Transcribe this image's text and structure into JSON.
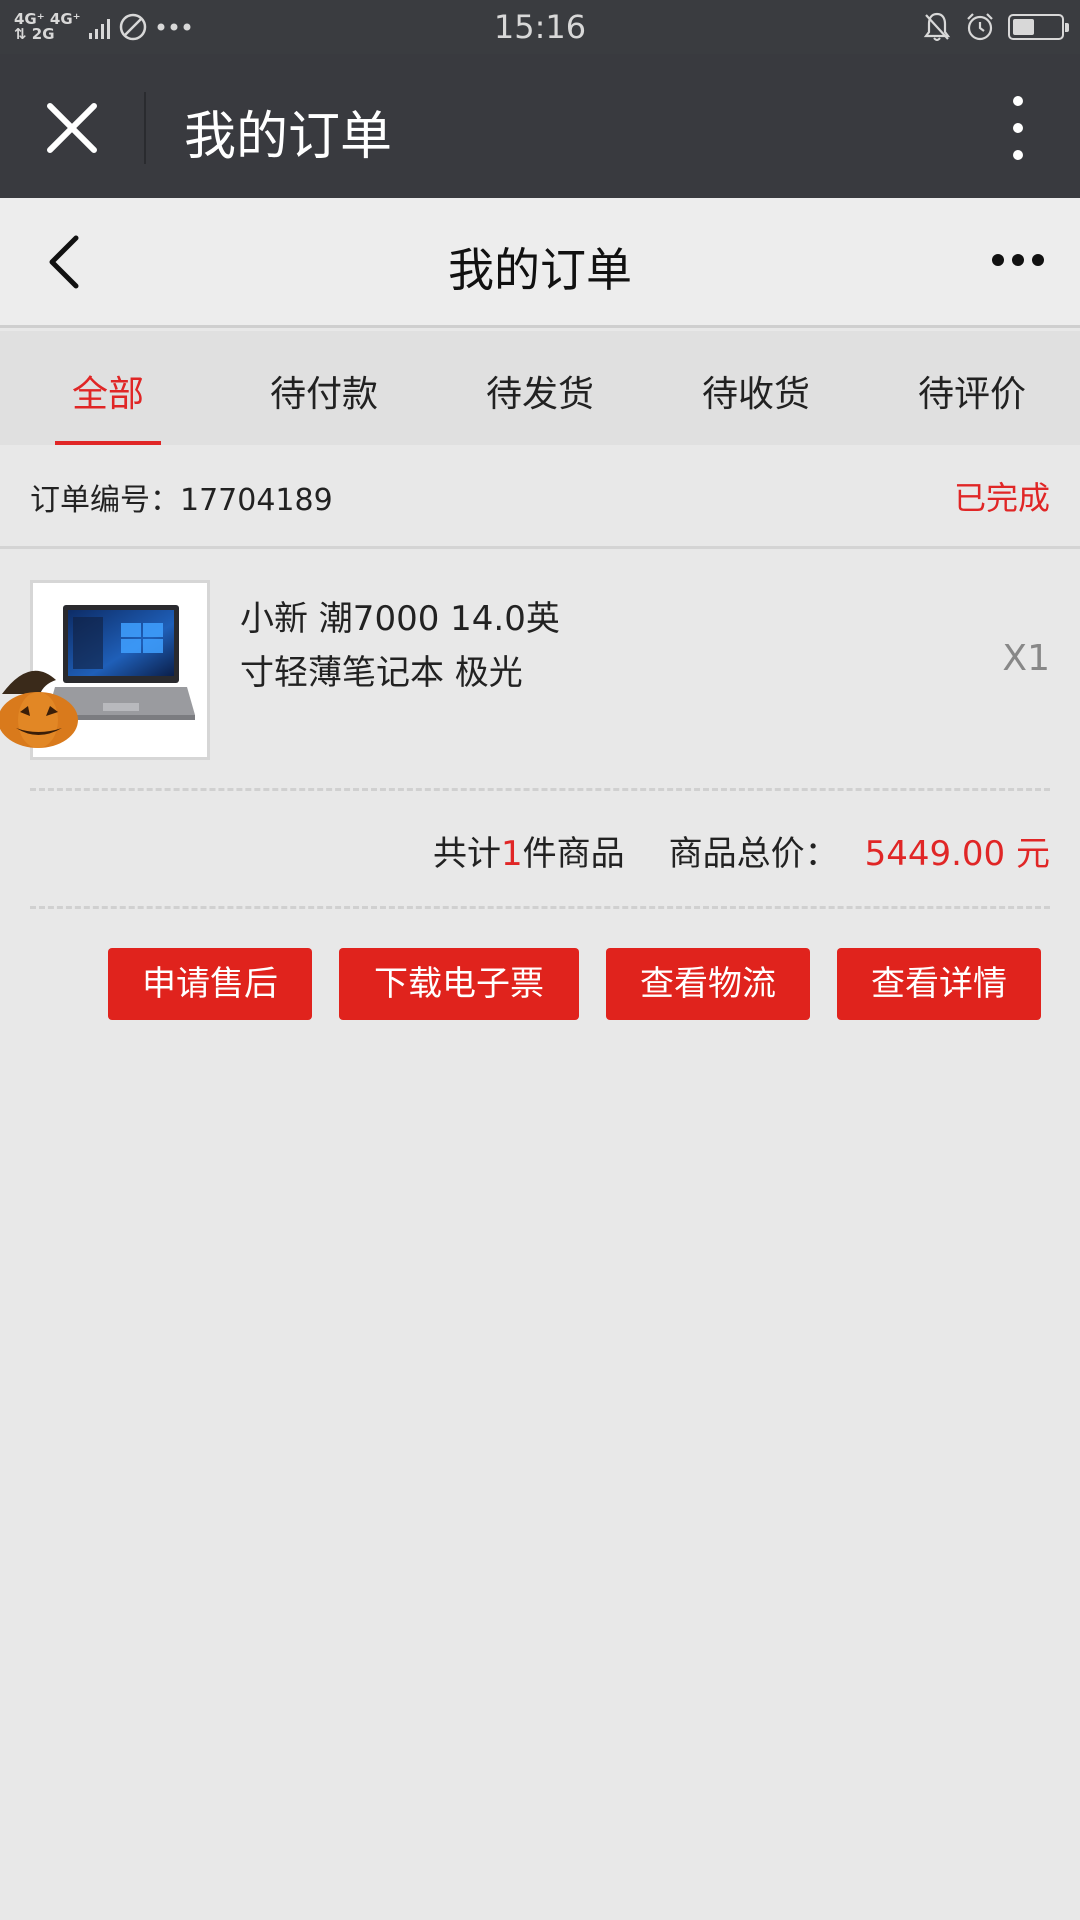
{
  "status_bar": {
    "network": [
      "4G⁺ 4G⁺",
      "⇅ 2G"
    ],
    "time": "15:16",
    "battery_level": 0.45
  },
  "wechat_bar": {
    "title": "我的订单",
    "close_icon": "close-icon",
    "more_icon": "vertical-dots-icon"
  },
  "header": {
    "title": "我的订单",
    "back_icon": "chevron-left-icon",
    "more_icon": "horizontal-dots-icon"
  },
  "tabs": [
    {
      "label": "全部",
      "active": true
    },
    {
      "label": "待付款",
      "active": false
    },
    {
      "label": "待发货",
      "active": false
    },
    {
      "label": "待收货",
      "active": false
    },
    {
      "label": "待评价",
      "active": false
    }
  ],
  "order": {
    "number_label": "订单编号：17704189",
    "status": "已完成",
    "product": {
      "name": "小新 潮7000 14.0英寸轻薄笔记本 极光",
      "quantity": "X1"
    },
    "summary": {
      "count_prefix": "共计",
      "count": "1",
      "count_suffix": "件商品",
      "total_label": "商品总价：",
      "total_value": "5449.00 元"
    },
    "actions": [
      "申请售后",
      "下载电子票",
      "查看物流",
      "查看详情"
    ]
  },
  "colors": {
    "accent": "#e02626",
    "wechat_bar": "#393a3f",
    "background": "#e8e8e8"
  }
}
